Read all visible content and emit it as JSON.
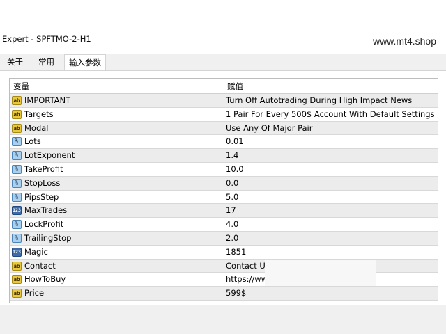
{
  "window": {
    "title": "Expert - SPFTMO-2-H1",
    "watermark": "www.mt4.shop"
  },
  "tabs": [
    {
      "label": "关于",
      "active": false
    },
    {
      "label": "常用",
      "active": false
    },
    {
      "label": "输入参数",
      "active": true
    }
  ],
  "grid": {
    "headers": {
      "variable": "变量",
      "value": "赋值"
    },
    "rows": [
      {
        "icon": "ab",
        "name": "IMPORTANT",
        "value": " Turn Off Autotrading During High Impact News"
      },
      {
        "icon": "ab",
        "name": "Targets",
        "value": "1 Pair For Every 500$ Account With Default Settings"
      },
      {
        "icon": "ab",
        "name": "Modal",
        "value": "Use Any Of Major Pair"
      },
      {
        "icon": "half",
        "name": "Lots",
        "value": "0.01"
      },
      {
        "icon": "half",
        "name": "LotExponent",
        "value": "1.4"
      },
      {
        "icon": "half",
        "name": "TakeProfit",
        "value": "10.0"
      },
      {
        "icon": "half",
        "name": "StopLoss",
        "value": "0.0"
      },
      {
        "icon": "half",
        "name": "PipsStep",
        "value": "5.0"
      },
      {
        "icon": "123",
        "name": "MaxTrades",
        "value": "17"
      },
      {
        "icon": "half",
        "name": "LockProfit",
        "value": "4.0"
      },
      {
        "icon": "half",
        "name": "TrailingStop",
        "value": "2.0"
      },
      {
        "icon": "123",
        "name": "Magic",
        "value": "1851"
      },
      {
        "icon": "ab",
        "name": "Contact",
        "value": "Contact Us"
      },
      {
        "icon": "ab",
        "name": "HowToBuy",
        "value": "https://www"
      },
      {
        "icon": "ab",
        "name": "Price",
        "value": "599$"
      }
    ]
  }
}
